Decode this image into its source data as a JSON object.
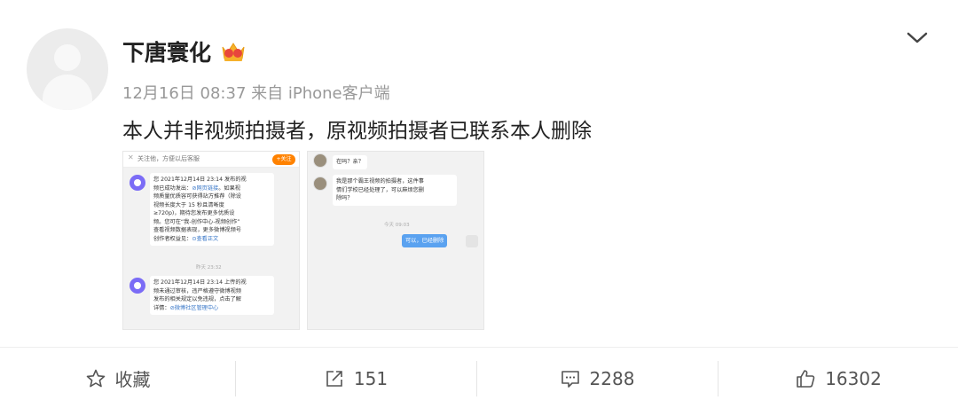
{
  "post": {
    "username": "下唐寰化",
    "meta": "12月16日 08:37 来自 iPhone客户端",
    "content": "本人并非视频拍摄者，原视频拍摄者已联系本人删除"
  },
  "screenshot_left": {
    "follow_text": "关注他，方便以后客服",
    "follow_button": "+关注",
    "msg1_a": "您 2021年12月14日 23:14 发布的视",
    "msg1_b": "频已成功发出：",
    "msg1_link1": "⊘网页链接",
    "msg1_c": "。如果视",
    "msg1_d": "频质量优质容可获得站方推荐（除设",
    "msg1_e": "视频长度大于 15 秒且清晰度",
    "msg1_f": "≥720p)，期待您发布更多优质设",
    "msg1_g": "频。您可在“我-创作中心-视频创作”",
    "msg1_h": "查看视频数据表现，更多微博视频号",
    "msg1_i": "创作者权益见：",
    "msg1_link2": "⊙查看正文",
    "time": "昨天 23:32",
    "msg2_a": "您 2021年12月14日 23:14 上传的视",
    "msg2_b": "频未通过审核，违严格遵守微博视频",
    "msg2_c": "发布的相关规定以免违规，点击了解",
    "msg2_d": "详情：",
    "msg2_link": "⊘微博社区管理中心"
  },
  "screenshot_right": {
    "msg1": "在吗？亲？",
    "msg2_a": "我是那个霸王视频的拍摄者，这件事",
    "msg2_b": "情们学校已经处理了，可以麻烦您删",
    "msg2_c": "除吗？",
    "time": "今天 09:03",
    "reply": "可以，已经删除"
  },
  "actions": {
    "favorite_label": "收藏",
    "repost_count": "151",
    "comment_count": "2288",
    "like_count": "16302"
  },
  "icons": [
    "chevron-down-icon",
    "crown-icon",
    "star-icon",
    "repost-icon",
    "comment-icon",
    "like-icon"
  ],
  "colors": {
    "follow_orange": "#ff8200",
    "reply_blue": "#5aa2f0",
    "link_blue": "#3a78c8"
  }
}
